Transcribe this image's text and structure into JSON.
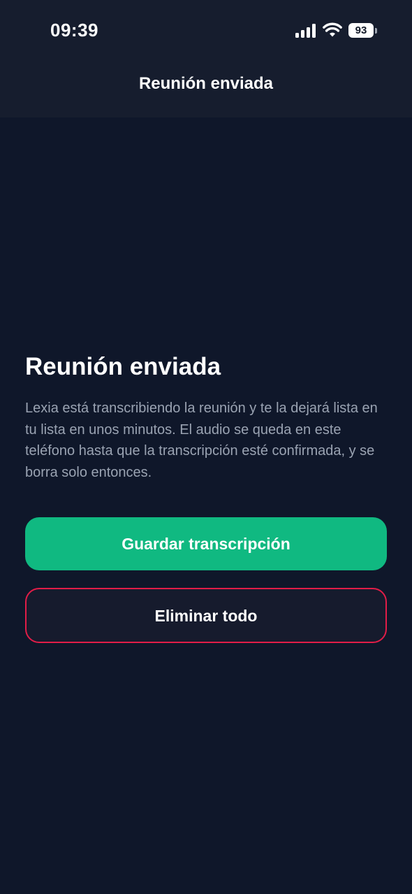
{
  "status_bar": {
    "time": "09:39",
    "battery_level": "93",
    "signal_bars": 4,
    "icons": [
      "cellular-signal-icon",
      "wifi-icon",
      "battery-icon"
    ]
  },
  "header": {
    "title": "Reunión enviada"
  },
  "main": {
    "heading": "Reunión enviada",
    "description": "Lexia está transcribiendo la reunión y te la dejará lista en tu lista en unos minutos. El audio se queda en este teléfono hasta que la transcripción esté confirmada, y se borra solo entonces."
  },
  "actions": {
    "save_label": "Guardar transcripción",
    "delete_label": "Eliminar todo"
  },
  "colors": {
    "background": "#0f172a",
    "header_background": "#161d2e",
    "primary": "#10b981",
    "danger_border": "#e11d48",
    "body_text": "#9aa3b2"
  }
}
